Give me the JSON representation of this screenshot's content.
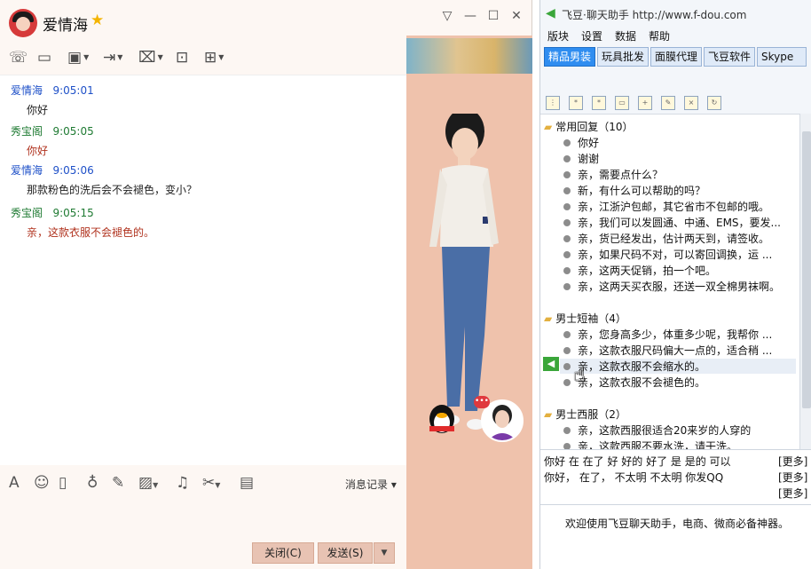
{
  "qq": {
    "contact_name": "爱情海",
    "window_buttons": [
      "▽",
      "—",
      "☐",
      "✕"
    ],
    "chat": [
      {
        "sender": "爱情海",
        "time": "9:05:01",
        "text": "你好",
        "style": "blue"
      },
      {
        "sender": "秀宝阁",
        "time": "9:05:05",
        "text": "你好",
        "style": "green"
      },
      {
        "sender": "爱情海",
        "time": "9:05:06",
        "text": "那款粉色的洗后会不会褪色，变小？",
        "style": "blue"
      },
      {
        "sender": "秀宝阁",
        "time": "9:05:15",
        "text": "亲，这款衣服不会褪色的。",
        "style": "green"
      }
    ],
    "history_label": "消息记录",
    "close_label": "关闭(C)",
    "send_label": "发送(S)",
    "badge": "•••"
  },
  "fd": {
    "app_title": "飞豆·聊天助手 http://www.f-dou.com",
    "menu": [
      "版块",
      "设置",
      "数据",
      "帮助"
    ],
    "categories": [
      "精品男装",
      "玩具批发",
      "面膜代理",
      "飞豆软件",
      "Skype"
    ],
    "active_category": "精品男装",
    "groups": [
      {
        "name": "常用回复（10）",
        "items": [
          "你好",
          "谢谢",
          "亲，需要点什么？",
          "新，有什么可以帮助的吗？",
          "亲，江浙沪包邮，其它省市不包邮的哦。",
          "亲，我们可以发圆通、中通、EMS，要发...",
          "亲，货已经发出，估计两天到，请签收。",
          "亲，如果尺码不对，可以寄回调换，运 ...",
          "亲，这两天促销，拍一个吧。",
          "亲，这两天买衣服，还送一双全棉男袜啊。"
        ]
      },
      {
        "name": "男士短袖（4）",
        "items": [
          "亲，您身高多少，体重多少呢，我帮你 ...",
          "亲，这款衣服尺码偏大一点的，适合稍 ...",
          "亲，这款衣服不会缩水的。",
          "亲，这款衣服不会褪色的。"
        ]
      },
      {
        "name": "男士西服（2）",
        "items": [
          "亲，这款西服很适合20来岁的人穿的",
          "亲，这款西服不要水洗，请干洗。"
        ]
      }
    ],
    "quick_rows": [
      "你好  在  在了  好  好的  好了  是  是的  可以",
      "你好，   在了，   不太明   不太明   你发QQ",
      ""
    ],
    "more_label": "[更多]",
    "welcome": "欢迎使用飞豆聊天助手，电商、微商必备神器。"
  }
}
